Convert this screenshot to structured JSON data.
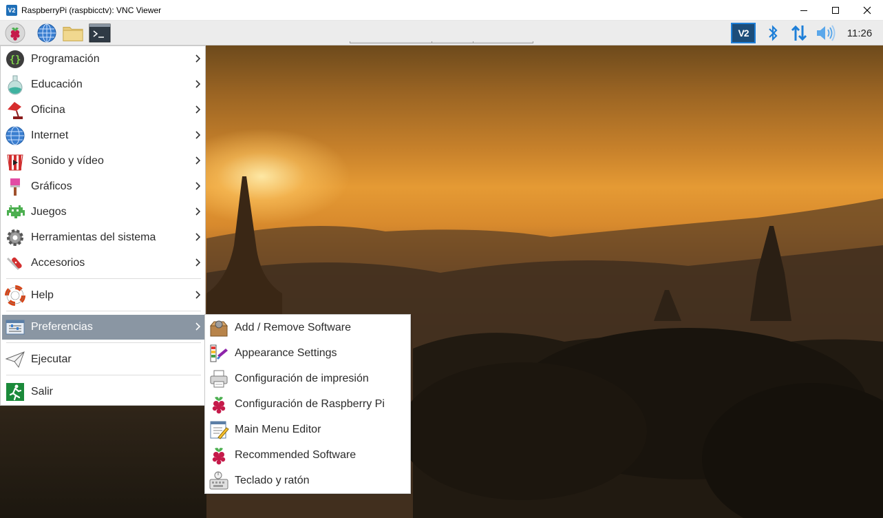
{
  "window": {
    "title": "RaspberryPi (raspbicctv): VNC Viewer",
    "icon": "vnc-icon",
    "controls": [
      "minimize-icon",
      "maximize-icon",
      "close-icon"
    ]
  },
  "taskbar": {
    "launchers": [
      "raspberry-pi-menu-icon",
      "web-browser-icon",
      "file-manager-icon",
      "terminal-icon"
    ],
    "tray": [
      "vnc-server-icon",
      "bluetooth-icon",
      "network-icon",
      "volume-icon"
    ],
    "clock": "11:26"
  },
  "main_menu": {
    "items": [
      {
        "label": "Programación",
        "icon": "programming-icon"
      },
      {
        "label": "Educación",
        "icon": "education-icon"
      },
      {
        "label": "Oficina",
        "icon": "office-icon"
      },
      {
        "label": "Internet",
        "icon": "internet-icon"
      },
      {
        "label": "Sonido y vídeo",
        "icon": "sound-video-icon"
      },
      {
        "label": "Gráficos",
        "icon": "graphics-icon"
      },
      {
        "label": "Juegos",
        "icon": "games-icon"
      },
      {
        "label": "Herramientas del sistema",
        "icon": "system-tools-icon"
      },
      {
        "label": "Accesorios",
        "icon": "accessories-icon"
      },
      {
        "label": "Help",
        "icon": "help-icon"
      },
      {
        "label": "Preferencias",
        "icon": "preferences-icon",
        "selected": true
      },
      {
        "label": "Ejecutar",
        "icon": "run-icon"
      },
      {
        "label": "Salir",
        "icon": "exit-icon"
      }
    ]
  },
  "preferences_submenu": {
    "items": [
      {
        "label": "Add / Remove Software",
        "icon": "add-remove-software-icon"
      },
      {
        "label": "Appearance Settings",
        "icon": "appearance-settings-icon"
      },
      {
        "label": "Configuración de impresión",
        "icon": "printer-icon"
      },
      {
        "label": "Configuración de Raspberry Pi",
        "icon": "raspberry-pi-config-icon"
      },
      {
        "label": "Main Menu Editor",
        "icon": "menu-editor-icon"
      },
      {
        "label": "Recommended Software",
        "icon": "recommended-software-icon"
      },
      {
        "label": "Teclado y ratón",
        "icon": "keyboard-mouse-icon"
      }
    ]
  },
  "colors": {
    "selected_item_bg": "#8a96a3",
    "raspberry_red": "#c51a4a",
    "accent_blue": "#1e7fd8"
  }
}
